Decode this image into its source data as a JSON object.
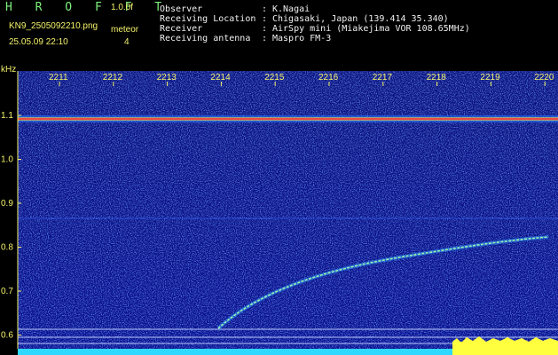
{
  "header": {
    "title": "H R O F F T",
    "version": "1.0.0f",
    "filename": "KN9_2505092210.png",
    "meteor_label": "meteor",
    "meteor_count": "4",
    "datetime": "25.05.09 22:10"
  },
  "observer_info": [
    {
      "key": "Observer",
      "value": "K.Nagai"
    },
    {
      "key": "Receiving Location",
      "value": "Chigasaki, Japan (139.414 35.340)"
    },
    {
      "key": "Receiver",
      "value": "AirSpy mini (Miakejima VOR 108.65MHz)"
    },
    {
      "key": "Receiving antenna",
      "value": "Maspro FM-3"
    }
  ],
  "axes": {
    "y_unit": "kHz",
    "y_ticks": [
      "1.1",
      "1.0",
      "0.9",
      "0.8",
      "0.7",
      "0.6"
    ],
    "x_ticks": [
      "2211",
      "2212",
      "2213",
      "2214",
      "2215",
      "2216",
      "2217",
      "2218",
      "2219",
      "2220"
    ]
  },
  "colors": {
    "background": "#000000",
    "noise_base": "#0a0e8a",
    "signal": "#ff3030",
    "echo": "#8ff0a0",
    "header_green": "#4df04d",
    "header_yellow": "#f4f26a",
    "bottom_cyan": "#2fd8ff",
    "bottom_yellow": "#ffff40"
  }
}
